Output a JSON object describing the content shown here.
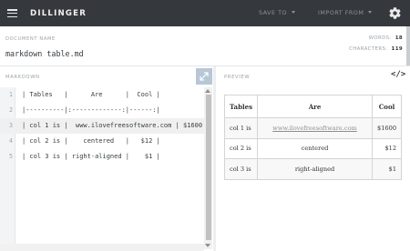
{
  "header": {
    "logo": "DILLINGER",
    "save_to": "SAVE TO",
    "import_from": "IMPORT FROM"
  },
  "document": {
    "label": "DOCUMENT NAME",
    "name": "markdown table.md",
    "words_label": "WORDS:",
    "words": "18",
    "characters_label": "CHARACTERS:",
    "characters": "119"
  },
  "panels": {
    "markdown_label": "MARKDOWN",
    "preview_label": "PREVIEW",
    "code_toggle": "</>"
  },
  "editor": {
    "lines": [
      {
        "n": "1",
        "text": "| Tables   |      Are      |  Cool |"
      },
      {
        "n": "2",
        "text": "|----------|:-------------:|------:|"
      },
      {
        "n": "3",
        "text": "| col 1 is |  www.ilovefreesoftware.com | $1600 |"
      },
      {
        "n": "4",
        "text": "| col 2 is |    centered   |   $12 |"
      },
      {
        "n": "5",
        "text": "| col 3 is | right-aligned |    $1 |"
      }
    ],
    "active_line": 3
  },
  "preview": {
    "headers": [
      "Tables",
      "Are",
      "Cool"
    ],
    "rows": [
      [
        "col 1 is",
        "www.ilovefreesoftware.com",
        "$1600"
      ],
      [
        "col 2 is",
        "centered",
        "$12"
      ],
      [
        "col 3 is",
        "right-aligned",
        "$1"
      ]
    ]
  },
  "icons": {
    "menu": "hamburger-icon",
    "settings": "gear-icon",
    "expand": "expand-icon",
    "save_caret": "chevron-down-icon",
    "import_caret": "chevron-down-icon"
  },
  "colors": {
    "topbar": "#35393e",
    "expand_button": "#b8c7d6",
    "link": "#8a8f94"
  }
}
